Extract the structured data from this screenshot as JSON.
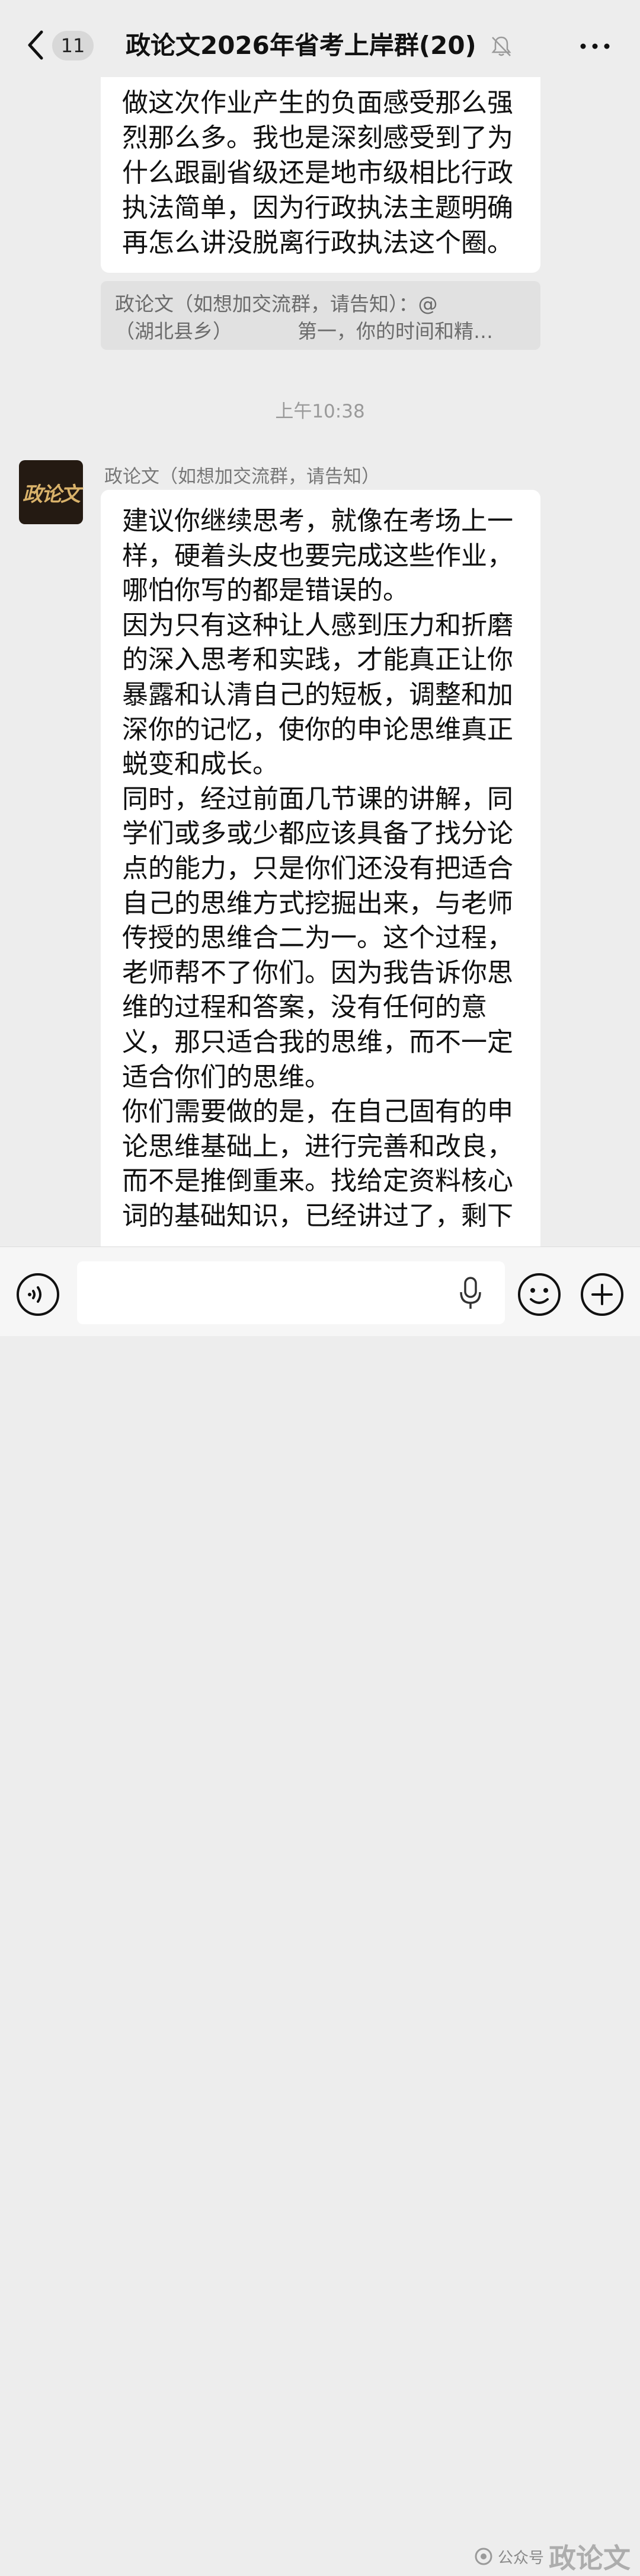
{
  "header": {
    "unread_count": "11",
    "title": "政论文2026年省考上岸群(20)"
  },
  "messages": {
    "previous_text": "做这次作业产生的负面感受那么强\n烈那么多。我也是深刻感受到了为\n什么跟副省级还是地市级相比行政\n执法简单，因为行政执法主题明确\n再怎么讲没脱离行政执法这个圈。",
    "quote_line1": "政论文（如想加交流群，请告知）：@",
    "quote_line2_a": "（湖北县乡）",
    "quote_line2_b": "第一，你的时间和精…",
    "timestamp": "上午10:38",
    "sender_name": "政论文（如想加交流群，请告知）",
    "avatar_logo_text": "政论文",
    "main_text": "建议你继续思考，就像在考场上一\n样，硬着头皮也要完成这些作业，\n哪怕你写的都是错误的。\n因为只有这种让人感到压力和折磨\n的深入思考和实践，才能真正让你\n暴露和认清自己的短板，调整和加\n深你的记忆，使你的申论思维真正\n蜕变和成长。\n同时，经过前面几节课的讲解，同\n学们或多或少都应该具备了找分论\n点的能力，只是你们还没有把适合\n自己的思维方式挖掘出来，与老师\n传授的思维合二为一。这个过程，\n老师帮不了你们。因为我告诉你思\n维的过程和答案，没有任何的意\n义，那只适合我的思维，而不一定\n适合你们的思维。\n你们需要做的是，在自己固有的申\n论思维基础上，进行完善和改良，\n而不是推倒重来。找给定资料核心\n词的基础知识，已经讲过了，剩下"
  },
  "input": {
    "value": "",
    "placeholder": ""
  },
  "watermark": {
    "small_text": "公众号",
    "big_text": "政论文"
  },
  "colors": {
    "background": "#ededed",
    "bubble": "#ffffff",
    "quote": "#e1e1e1",
    "avatar_bg": "#241a12",
    "avatar_text": "#d9b26a"
  },
  "icons": [
    "back-chevron-icon",
    "mute-bell-icon",
    "more-icon",
    "voice-icon",
    "mic-icon",
    "emoji-icon",
    "plus-icon"
  ]
}
